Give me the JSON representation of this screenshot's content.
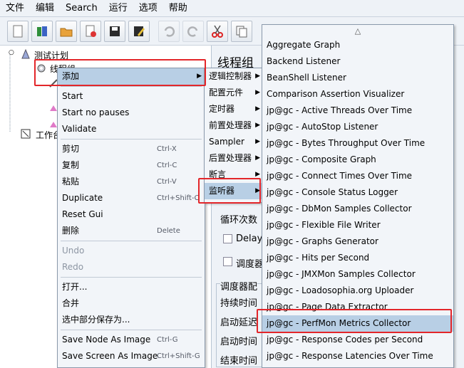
{
  "menubar": [
    "文件",
    "编辑",
    "Search",
    "运行",
    "选项",
    "帮助"
  ],
  "tree": {
    "test_plan": "测试计划",
    "thread_group": "线程组",
    "workbench": "工作台"
  },
  "content": {
    "title": "线程组",
    "loop_count_label": "循环次数",
    "delay_label": "Delay T",
    "scheduler_label": "调度器",
    "scheduler_config_label": "调度器配",
    "duration_label": "持续时间",
    "startup_delay_label": "启动延迟",
    "start_time_label": "启动时间",
    "end_time_label": "结束时间"
  },
  "context_menu": [
    {
      "label": "添加",
      "submenu": true,
      "highlight": true
    },
    {
      "sep": true
    },
    {
      "label": "Start"
    },
    {
      "label": "Start no pauses"
    },
    {
      "label": "Validate"
    },
    {
      "sep": true
    },
    {
      "label": "剪切",
      "shortcut": "Ctrl-X"
    },
    {
      "label": "复制",
      "shortcut": "Ctrl-C"
    },
    {
      "label": "粘贴",
      "shortcut": "Ctrl-V"
    },
    {
      "label": "Duplicate",
      "shortcut": "Ctrl+Shift-C"
    },
    {
      "label": "Reset Gui"
    },
    {
      "label": "删除",
      "shortcut": "Delete"
    },
    {
      "sep": true
    },
    {
      "label": "Undo",
      "disabled": true
    },
    {
      "label": "Redo",
      "disabled": true
    },
    {
      "sep": true
    },
    {
      "label": "打开..."
    },
    {
      "label": "合并"
    },
    {
      "label": "选中部分保存为..."
    },
    {
      "sep": true
    },
    {
      "label": "Save Node As Image",
      "shortcut": "Ctrl-G"
    },
    {
      "label": "Save Screen As Image",
      "shortcut": "Ctrl+Shift-G"
    }
  ],
  "add_menu": [
    {
      "label": "逻辑控制器",
      "submenu": true
    },
    {
      "label": "配置元件",
      "submenu": true
    },
    {
      "label": "定时器",
      "submenu": true
    },
    {
      "label": "前置处理器",
      "submenu": true
    },
    {
      "label": "Sampler",
      "submenu": true
    },
    {
      "label": "后置处理器",
      "submenu": true
    },
    {
      "label": "断言",
      "submenu": true
    },
    {
      "label": "监听器",
      "submenu": true,
      "highlight": true
    }
  ],
  "listener_menu": {
    "scroll_up": "△",
    "items": [
      "Aggregate Graph",
      "Backend Listener",
      "BeanShell Listener",
      "Comparison Assertion Visualizer",
      "jp@gc - Active Threads Over Time",
      "jp@gc - AutoStop Listener",
      "jp@gc - Bytes Throughput Over Time",
      "jp@gc - Composite Graph",
      "jp@gc - Connect Times Over Time",
      "jp@gc - Console Status Logger",
      "jp@gc - DbMon Samples Collector",
      "jp@gc - Flexible File Writer",
      "jp@gc - Graphs Generator",
      "jp@gc - Hits per Second",
      "jp@gc - JMXMon Samples Collector",
      "jp@gc - Loadosophia.org Uploader",
      "jp@gc - Page Data Extractor",
      "jp@gc - PerfMon Metrics Collector",
      "jp@gc - Response Codes per Second",
      "jp@gc - Response Latencies Over Time"
    ],
    "highlight_index": 17
  },
  "colors": {
    "highlight": "#b8cfe5",
    "annotation": "#e3262a",
    "background": "#eef2f7"
  }
}
